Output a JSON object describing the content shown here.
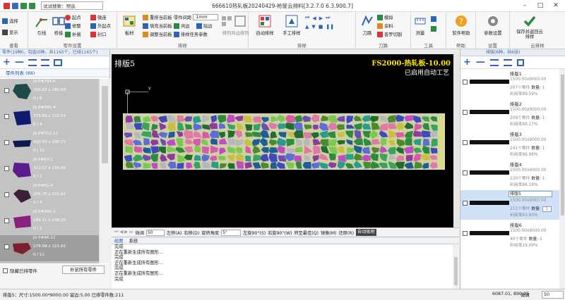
{
  "window": {
    "title": "666610热轧板20240429-枪筐云排料[3.2.7.0 6.3.900.7]",
    "search_label": "试试搜索：",
    "search_value": "预选",
    "controls": [
      "–",
      "□",
      "✕"
    ]
  },
  "ribbon": {
    "groups": {
      "view": "查看",
      "parts": "零件设置",
      "nest": "排样",
      "nest2": "排样",
      "cut": "刀路",
      "tools": "工具",
      "help": "帮助",
      "settings": "设置",
      "save": "云排样"
    },
    "select_label": "选择",
    "display_label": "显示",
    "lead_label": "引线",
    "bridge_label": "桥接",
    "start_label": "起点",
    "reorder_label": "修整",
    "fill_label": "补偿",
    "micro_label": "微连",
    "outer_label": "外起点",
    "seal_label": "封口",
    "sheet_label": "板材",
    "reset_current": "重排当前板",
    "fill_current": "填充当前板",
    "adjust_current": "调整当前板",
    "gap_label": "零件间距",
    "gap_value": "1mm",
    "common_label": "共边",
    "stick_label": "贴边",
    "param_label": "排样任务参数",
    "align_label": "排列",
    "common_align_label": "共边排列",
    "auto_nest": "自动排样",
    "manual_nest": "手工排样",
    "path_label": "刀路",
    "sim_label": "模拟",
    "material_label": "余料",
    "shear_label": "普罗切割",
    "measure_label": "测量",
    "help_btn": "软件帮助",
    "param_btn": "参数设置",
    "save_btn": "保存并返回云排样"
  },
  "left_panel": {
    "header": "零件(19种)，勾选(0种，共1165个，已排1165个)",
    "tab": "零件列表 (88)",
    "parts": [
      {
        "name": "J0-P#794-6",
        "dims": "309.63 x 285.68",
        "count": "0 / 6",
        "color": "#1e4a48"
      },
      {
        "name": "J0-P#995-4",
        "dims": "375.89 x 222.54",
        "count": "0 / 4",
        "color": "#101a70"
      },
      {
        "name": "J0-P#752-12",
        "dims": "410.55 x 106.73",
        "count": "0 / 12",
        "color": "#101850"
      },
      {
        "name": "J0-P#63-2",
        "dims": "322.07 x 234.80",
        "count": "0 / 2",
        "color": "#5a1c8c"
      },
      {
        "name": "J0-P#62-4",
        "dims": "256.70 x 225.82",
        "count": "0 / 4",
        "color": "#3a1f3a"
      },
      {
        "name": "J0-P#995-2",
        "dims": "184.11 x 138.20",
        "count": "0 / 2",
        "color": "#8a1f7e"
      },
      {
        "name": "J0-P#96-11",
        "dims": "279.09 x 221.65",
        "count": "0 / 11",
        "color": "#7a2030"
      }
    ],
    "hide_label": "隐藏已排零件",
    "fill_all": "补足所有零件"
  },
  "canvas": {
    "sheet_name": "排版5",
    "sheet_info": "FS2000-热轧板-10.00",
    "auto_note": "已启用自动工艺"
  },
  "canvas_bar": {
    "zoom_label": "微调",
    "zoom_value": "50",
    "left_btn": "左移(A)",
    "right_btn": "右移(D)",
    "rot_label": "旋转角度",
    "rot_value": "5°",
    "ccw": "左旋90°(S)",
    "cw": "右旋90°(W)",
    "best": "转至最佳(Q)",
    "mirror": "镜像(M)",
    "reset": "还原(R)",
    "auto": "自动吸附"
  },
  "log": {
    "tabs": [
      "绘图",
      "系统"
    ],
    "lines": [
      "完成",
      "正在重新生成所有图形...",
      "完成",
      "正在重新生成所有图形...",
      "完成",
      "正在重新生成所有图形...",
      "完成"
    ]
  },
  "right_panel": {
    "header": "排版(6种，共6张)",
    "sheets": [
      {
        "name": "排版1",
        "size": "1500.00x9000.00",
        "parts": "207个零件",
        "qty_label": "数量:",
        "qty": "1",
        "rate": "利用率89.59%"
      },
      {
        "name": "排版2",
        "size": "1500.00x9000.00",
        "parts": "209个零件",
        "qty_label": "数量:",
        "qty": "1",
        "rate": "利用率88.17%"
      },
      {
        "name": "排版3",
        "size": "1500.00x9000.00",
        "parts": "241个零件",
        "qty_label": "数量:",
        "qty": "1",
        "rate": "利用率86.98%"
      },
      {
        "name": "排版4",
        "size": "1500.00x9000.00",
        "parts": "220个零件",
        "qty_label": "数量:",
        "qty": "1",
        "rate": "利用率86.18%"
      },
      {
        "name": "排版5",
        "size": "1500.00x9000.00",
        "parts": "211个零件",
        "qty_label": "数量:",
        "qty": "1",
        "rate": "利用率83.80%"
      },
      {
        "name": "排版6",
        "size": "1500.00x9000.00",
        "parts": "40个零件",
        "qty_label": "数量:",
        "qty": "1",
        "rate": "利用率19.09%"
      }
    ]
  },
  "status": {
    "text": "排版5：尺寸:1500.00*9000.00  留边:5.00  已排零件数:211",
    "coords": "6087.01, 890.95",
    "zoom_label": "微调",
    "zoom_value": "50"
  }
}
